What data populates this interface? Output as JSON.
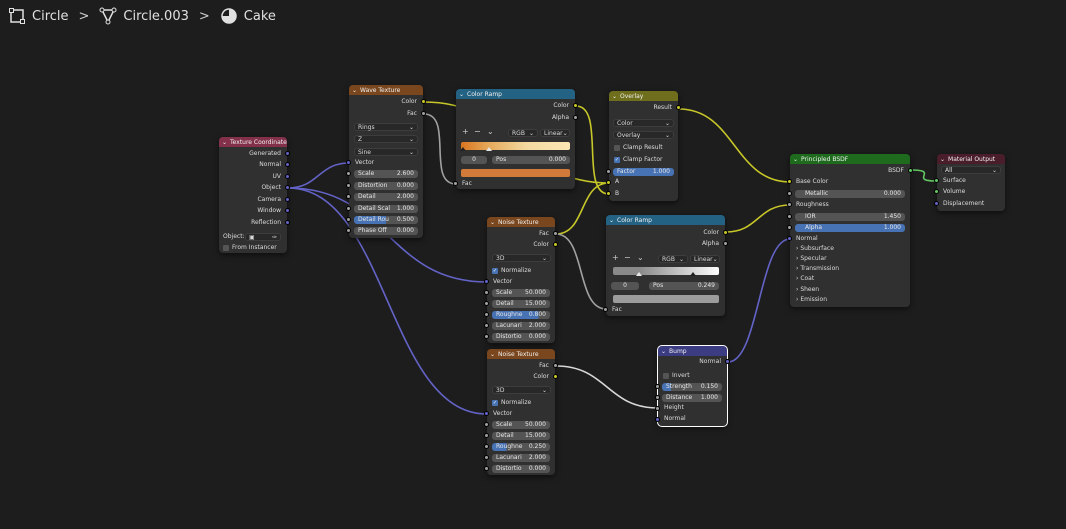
{
  "breadcrumb": {
    "items": [
      "Circle",
      "Circle.003",
      "Cake"
    ]
  },
  "nodes": {
    "texcoord": {
      "title": "Texture Coordinate",
      "outputs": [
        "Generated",
        "Normal",
        "UV",
        "Object",
        "Camera",
        "Window",
        "Reflection"
      ],
      "object_label": "Object:",
      "from_instancer": "From Instancer"
    },
    "wave": {
      "title": "Wave Texture",
      "outputs": [
        "Color",
        "Fac"
      ],
      "drop1": "Rings",
      "drop2": "Z",
      "drop3": "Sine",
      "vector": "Vector",
      "fields": [
        {
          "l": "Scale",
          "v": "2.600"
        },
        {
          "l": "Distortion",
          "v": "0.000"
        },
        {
          "l": "Detail",
          "v": "2.000"
        },
        {
          "l": "Detail Scal",
          "v": "1.000"
        },
        {
          "l": "Detail Rou",
          "v": "0.500"
        },
        {
          "l": "Phase Off",
          "v": "0.000"
        }
      ]
    },
    "ramp1": {
      "title": "Color Ramp",
      "outputs": [
        "Color",
        "Alpha"
      ],
      "mode": "RGB",
      "interp": "Linear",
      "index": "0",
      "pos_label": "Pos",
      "pos": "0.000",
      "fac": "Fac"
    },
    "overlay": {
      "title": "Overlay",
      "output": "Result",
      "drop1": "Color",
      "drop2": "Overlay",
      "clamp_result": "Clamp Result",
      "clamp_factor": "Clamp Factor",
      "factor_label": "Factor",
      "factor": "1.000",
      "a": "A",
      "b": "B"
    },
    "noise1": {
      "title": "Noise Texture",
      "outputs": [
        "Fac",
        "Color"
      ],
      "dim": "3D",
      "normalize": "Normalize",
      "vector": "Vector",
      "fields": [
        {
          "l": "Scale",
          "v": "50.000"
        },
        {
          "l": "Detail",
          "v": "15.000"
        },
        {
          "l": "Roughne",
          "v": "0.800"
        },
        {
          "l": "Lacunari",
          "v": "2.000"
        },
        {
          "l": "Distortio",
          "v": "0.000"
        }
      ]
    },
    "ramp2": {
      "title": "Color Ramp",
      "outputs": [
        "Color",
        "Alpha"
      ],
      "mode": "RGB",
      "interp": "Linear",
      "index": "0",
      "pos_label": "Pos",
      "pos": "0.249",
      "fac": "Fac"
    },
    "bsdf": {
      "title": "Principled BSDF",
      "output": "BSDF",
      "base_color": "Base Color",
      "fields": [
        {
          "l": "Metallic",
          "v": "0.000"
        },
        {
          "l": "IOR",
          "v": "1.450"
        },
        {
          "l": "Alpha",
          "v": "1.000"
        }
      ],
      "roughness": "Roughness",
      "normal": "Normal",
      "panels": [
        "Subsurface",
        "Specular",
        "Transmission",
        "Coat",
        "Sheen",
        "Emission"
      ]
    },
    "matout": {
      "title": "Material Output",
      "target": "All",
      "inputs": [
        "Surface",
        "Volume",
        "Displacement"
      ]
    },
    "noise2": {
      "title": "Noise Texture",
      "outputs": [
        "Fac",
        "Color"
      ],
      "dim": "3D",
      "normalize": "Normalize",
      "vector": "Vector",
      "fields": [
        {
          "l": "Scale",
          "v": "50.000"
        },
        {
          "l": "Detail",
          "v": "15.000"
        },
        {
          "l": "Roughne",
          "v": "0.250"
        },
        {
          "l": "Lacunari",
          "v": "2.000"
        },
        {
          "l": "Distortio",
          "v": "0.000"
        }
      ]
    },
    "bump": {
      "title": "Bump",
      "output": "Normal",
      "invert": "Invert",
      "fields": [
        {
          "l": "Strength",
          "v": "0.150"
        },
        {
          "l": "Distance",
          "v": "1.000"
        }
      ],
      "height": "Height",
      "normal_in": "Normal"
    }
  },
  "colors": {
    "vector_socket": "#6363c7",
    "color_socket": "#c7c729",
    "float_socket": "#a1a1a1",
    "shader_socket": "#63c763",
    "hdr_input": "#83314a",
    "hdr_texture": "#79461d",
    "hdr_converter": "#246283",
    "hdr_color": "#6e6e1d",
    "hdr_shader": "#1e6b1e",
    "hdr_output": "#4a1d2a",
    "hdr_vector": "#3c3c83"
  }
}
